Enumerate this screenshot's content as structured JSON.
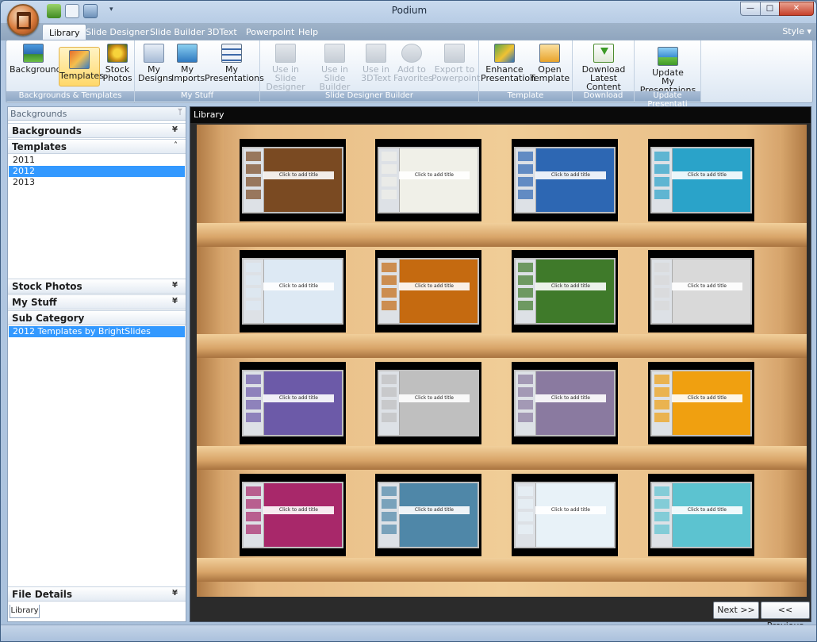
{
  "window": {
    "title": "Podium",
    "min": "—",
    "max": "□",
    "close": "✕"
  },
  "tabs": [
    "Library",
    "Slide Designer",
    "Slide Builder",
    "3DText",
    "Powerpoint",
    "Help"
  ],
  "style_menu": "Style",
  "ribbon": {
    "groups": [
      {
        "label": "Backgrounds & Templates"
      },
      {
        "label": "My Stuff"
      },
      {
        "label": "Slide Designer Builder"
      },
      {
        "label": "Template"
      },
      {
        "label": "Download"
      },
      {
        "label": "Update Presentati"
      }
    ],
    "buttons": {
      "background": [
        "Background"
      ],
      "templates": [
        "Templates"
      ],
      "stock_photos": [
        "Stock",
        "Photos"
      ],
      "my_designs": [
        "My",
        "Designs"
      ],
      "my_imports": [
        "My",
        "Imports"
      ],
      "my_presentations": [
        "My",
        "Presentations"
      ],
      "use_slide_designer": [
        "Use in Slide",
        "Designer"
      ],
      "use_slide_builder": [
        "Use in",
        "Slide Builder"
      ],
      "use_3dtext": [
        "Use in",
        "3DText"
      ],
      "add_favorites": [
        "Add to",
        "Favorites"
      ],
      "export_powerpoint": [
        "Export to",
        "Powerpoint"
      ],
      "enhance_presentation": [
        "Enhance",
        "Presentation"
      ],
      "open_template": [
        "Open",
        "Template"
      ],
      "download_latest": [
        "Download",
        "Latest Content"
      ],
      "update_presentations": [
        "Update",
        "My Presentaions"
      ]
    }
  },
  "left_panel": {
    "header": "Backgrounds",
    "pin": "ᛘ",
    "sections": {
      "backgrounds": "Backgrounds",
      "templates": "Templates",
      "stock_photos": "Stock Photos",
      "my_stuff": "My Stuff",
      "sub_category": "Sub Category",
      "file_details": "File Details"
    },
    "template_years": [
      "2011",
      "2012",
      "2013"
    ],
    "selected_year": "2012",
    "sub_category_items": [
      "2012 Templates by BrightSlides"
    ],
    "bottom_tab": "Library"
  },
  "library": {
    "title": "Library",
    "thumbnails": [
      {
        "caption": "Click to add title",
        "bg": "#7a4a22"
      },
      {
        "caption": "Click to add title",
        "bg": "#f0f0e8"
      },
      {
        "caption": "Click to add title",
        "bg": "#2d67b3"
      },
      {
        "caption": "Click to add title",
        "bg": "#2aa3c9"
      },
      {
        "caption": "Click to add title",
        "bg": "#dde9f4"
      },
      {
        "caption": "Click to add title",
        "bg": "#c56a10"
      },
      {
        "caption": "Click to add title",
        "bg": "#3f7a2a"
      },
      {
        "caption": "Click to add title",
        "bg": "#d9d9d9"
      },
      {
        "caption": "Click to add title",
        "bg": "#6c5aa8"
      },
      {
        "caption": "Click to add title",
        "bg": "#bfbfbf"
      },
      {
        "caption": "Click to add title",
        "bg": "#8a7aa0"
      },
      {
        "caption": "Click to add title",
        "bg": "#f0a010"
      },
      {
        "caption": "Click to add title",
        "bg": "#a8286a"
      },
      {
        "caption": "Click to add title",
        "bg": "#4f87a8"
      },
      {
        "caption": "Click to add title",
        "bg": "#e8f2f8"
      },
      {
        "caption": "Click to add title",
        "bg": "#5cc3d0"
      }
    ],
    "next": "Next >>",
    "previous": "<< Previous"
  }
}
